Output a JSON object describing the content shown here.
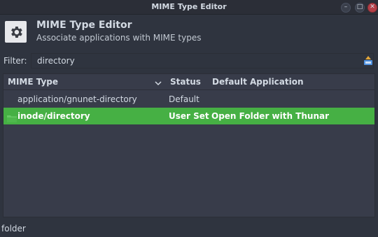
{
  "window": {
    "title": "MIME Type Editor"
  },
  "header": {
    "title": "MIME Type Editor",
    "subtitle": "Associate applications with MIME types"
  },
  "filter": {
    "label": "Filter:",
    "value": "directory"
  },
  "table": {
    "columns": [
      "MIME Type",
      "Status",
      "Default Application"
    ],
    "rows": [
      {
        "mime": "application/gnunet-directory",
        "status": "Default",
        "app": ""
      },
      {
        "mime": "inode/directory",
        "status": "User Set",
        "app": "Open Folder with Thunar"
      }
    ]
  },
  "status_bar": {
    "text": "folder"
  },
  "icons": {
    "app": "gear-icon",
    "clear": "clear-filter-icon",
    "sort": "chevron-down-icon",
    "folder": "folder-icon"
  },
  "colors": {
    "selection": "#46b044",
    "background": "#2f343f",
    "close": "#b53f47"
  }
}
